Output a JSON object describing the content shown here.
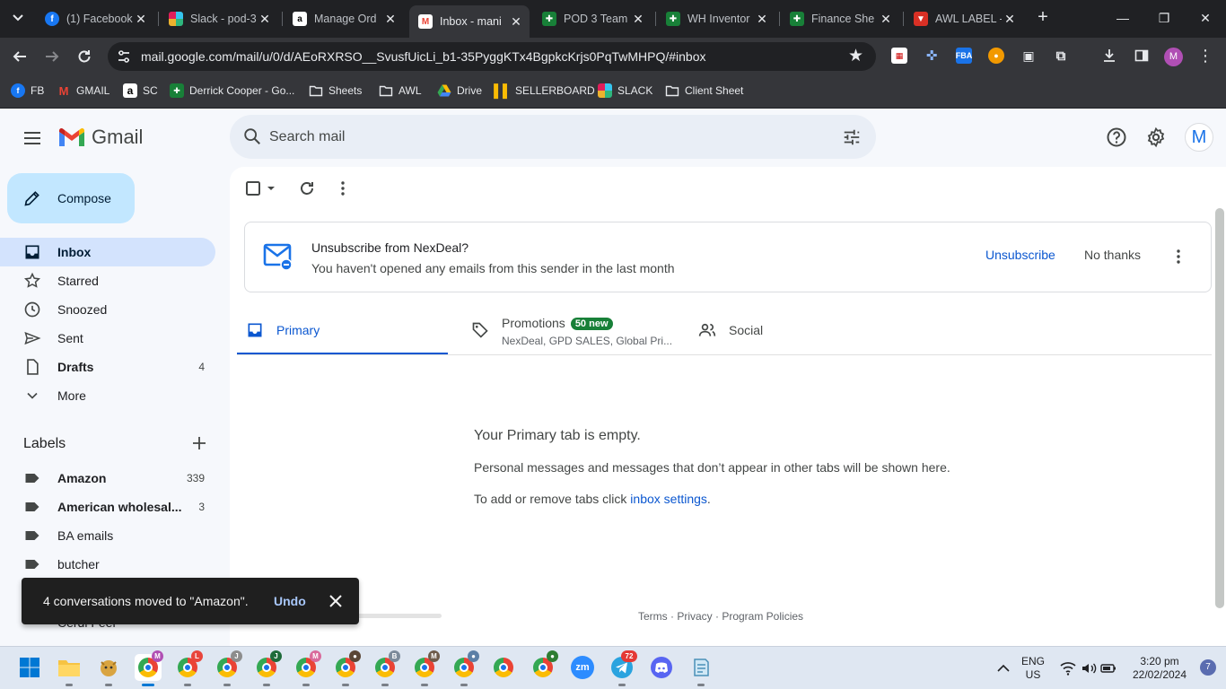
{
  "browser": {
    "tabs": [
      {
        "label": "(1) Facebook",
        "favicon": "facebook-icon",
        "color": "#1877f2"
      },
      {
        "label": "Slack - pod-3",
        "favicon": "slack-icon",
        "color": "#611f69"
      },
      {
        "label": "Manage Ord",
        "favicon": "amazon-icon",
        "color": "#000000"
      },
      {
        "label": "Inbox - mani",
        "favicon": "gmail-icon",
        "color": "#ea4335",
        "active": true
      },
      {
        "label": "POD 3 Team",
        "favicon": "sheets-icon",
        "color": "#188038"
      },
      {
        "label": "WH Inventor",
        "favicon": "sheets-icon",
        "color": "#188038"
      },
      {
        "label": "Finance She",
        "favicon": "sheets-icon",
        "color": "#188038"
      },
      {
        "label": "AWL LABEL -",
        "favicon": "awl-icon",
        "color": "#d93025"
      }
    ],
    "url": "mail.google.com/mail/u/0/d/AEoRXRSO__SvusfUicLi_b1-35PyggKTx4BgpkcKrjs0PqTwMHPQ/#inbox",
    "profile_initial": "M",
    "bookmarks": [
      {
        "label": "FB"
      },
      {
        "label": "GMAIL"
      },
      {
        "label": "SC"
      },
      {
        "label": "Derrick Cooper - Go..."
      },
      {
        "label": "Sheets"
      },
      {
        "label": "AWL"
      },
      {
        "label": "Drive"
      },
      {
        "label": "SELLERBOARD"
      },
      {
        "label": "SLACK"
      },
      {
        "label": "Client Sheet"
      }
    ]
  },
  "gmail": {
    "app_name": "Gmail",
    "search_placeholder": "Search mail",
    "avatar_initial": "M",
    "compose_label": "Compose",
    "nav": [
      {
        "label": "Inbox",
        "count": "",
        "icon": "inbox-icon",
        "active": true
      },
      {
        "label": "Starred",
        "count": "",
        "icon": "star-icon"
      },
      {
        "label": "Snoozed",
        "count": "",
        "icon": "clock-icon"
      },
      {
        "label": "Sent",
        "count": "",
        "icon": "send-icon"
      },
      {
        "label": "Drafts",
        "count": "4",
        "icon": "draft-icon"
      },
      {
        "label": "More",
        "count": "",
        "icon": "chevron-down-icon"
      }
    ],
    "labels_header": "Labels",
    "labels": [
      {
        "label": "Amazon",
        "count": "339",
        "bold": true
      },
      {
        "label": "American wholesal...",
        "count": "3",
        "bold": true
      },
      {
        "label": "BA emails",
        "count": "",
        "bold": false
      },
      {
        "label": "butcher",
        "count": "",
        "bold": false
      }
    ],
    "hidden_label": "Cerdi Feer",
    "unsubscribe_banner": {
      "title": "Unsubscribe from NexDeal?",
      "subtitle": "You haven't opened any emails from this sender in the last month",
      "unsubscribe_label": "Unsubscribe",
      "no_thanks_label": "No thanks"
    },
    "category_tabs": [
      {
        "label": "Primary",
        "sub": "",
        "badge": ""
      },
      {
        "label": "Promotions",
        "sub": "NexDeal, GPD SALES, Global Pri...",
        "badge": "50 new"
      },
      {
        "label": "Social",
        "sub": "",
        "badge": ""
      }
    ],
    "empty_state": {
      "title": "Your Primary tab is empty.",
      "message": "Personal messages and messages that don’t appear in other tabs will be shown here.",
      "hint_prefix": "To add or remove tabs click ",
      "hint_link": "inbox settings",
      "hint_suffix": "."
    },
    "footer_links": "Terms · Privacy · Program Policies",
    "snackbar": {
      "message": "4 conversations moved to \"Amazon\".",
      "undo_label": "Undo"
    }
  },
  "taskbar": {
    "language": "ENG",
    "region": "US",
    "time": "3:20 pm",
    "date": "22/02/2024",
    "notification_count": "7",
    "telegram_badge": "72",
    "zoom_label": "zm"
  },
  "colors": {
    "gmail_red": "#ea4335",
    "compose_bg": "#c2e7ff",
    "active_nav_bg": "#d3e3fd",
    "link_blue": "#0b57d0",
    "badge_green": "#188038"
  }
}
